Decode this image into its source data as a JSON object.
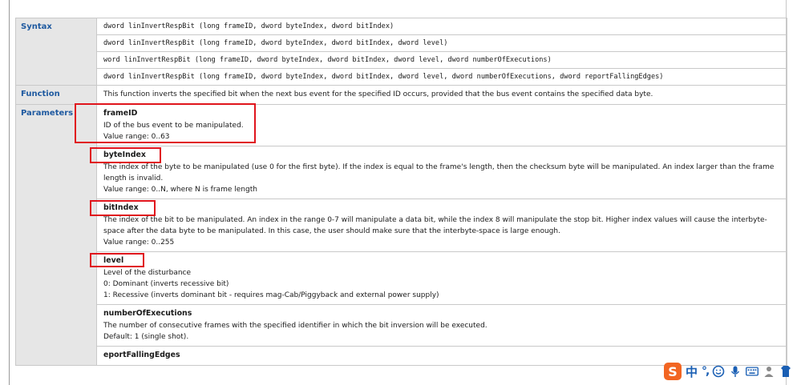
{
  "labels": {
    "syntax": "Syntax",
    "function": "Function",
    "parameters": "Parameters"
  },
  "syntax": [
    "dword linInvertRespBit (long frameID, dword byteIndex, dword bitIndex)",
    "dword linInvertRespBit (long frameID, dword byteIndex, dword bitIndex, dword level)",
    "word linInvertRespBit (long frameID, dword byteIndex, dword bitIndex, dword level, dword numberOfExecutions)",
    "dword linInvertRespBit (long frameID, dword byteIndex, dword bitIndex, dword level, dword numberOfExecutions, dword reportFallingEdges)"
  ],
  "function_text": "This function inverts the specified bit when the next bus event for the specified ID occurs, provided that the bus event contains the specified data byte.",
  "parameters": {
    "frameID": {
      "name": "frameID",
      "desc": "ID of the bus event to be manipulated.",
      "value": "Value range: 0..63"
    },
    "byteIndex": {
      "name": "byteIndex",
      "desc": "The index of the byte to be manipulated (use 0 for the first byte). If the index is equal to the frame's length, then the checksum byte will be manipulated. An index larger than the frame length is invalid.",
      "value": "Value range: 0..N, where N is frame length"
    },
    "bitIndex": {
      "name": "bitIndex",
      "desc": "The index of the bit to be manipulated. An index in the range 0-7 will manipulate a data bit, while the index 8 will manipulate the stop bit. Higher index values will cause the interbyte-space after the data byte to be manipulated. In this case, the user should make sure that the interbyte-space is large enough.",
      "value": "Value range: 0..255"
    },
    "level": {
      "name": "level",
      "desc": "Level of the disturbance",
      "opt0": "0: Dominant (inverts recessive bit)",
      "opt1": "1: Recessive (inverts dominant bit - requires mag-Cab/Piggyback and external power supply)"
    },
    "numberOfExecutions": {
      "name": "numberOfExecutions",
      "desc": "The number of consecutive frames with the specified identifier in which the bit inversion will be executed.",
      "value": "Default: 1 (single shot)."
    },
    "reportFallingEdges": {
      "name": "eportFallingEdges"
    }
  },
  "ime": {
    "logo": "S",
    "lang": "中",
    "punct": "°,",
    "icons": [
      "smiley-icon",
      "microphone-icon",
      "keyboard-icon",
      "user-icon",
      "shirt-icon"
    ]
  }
}
